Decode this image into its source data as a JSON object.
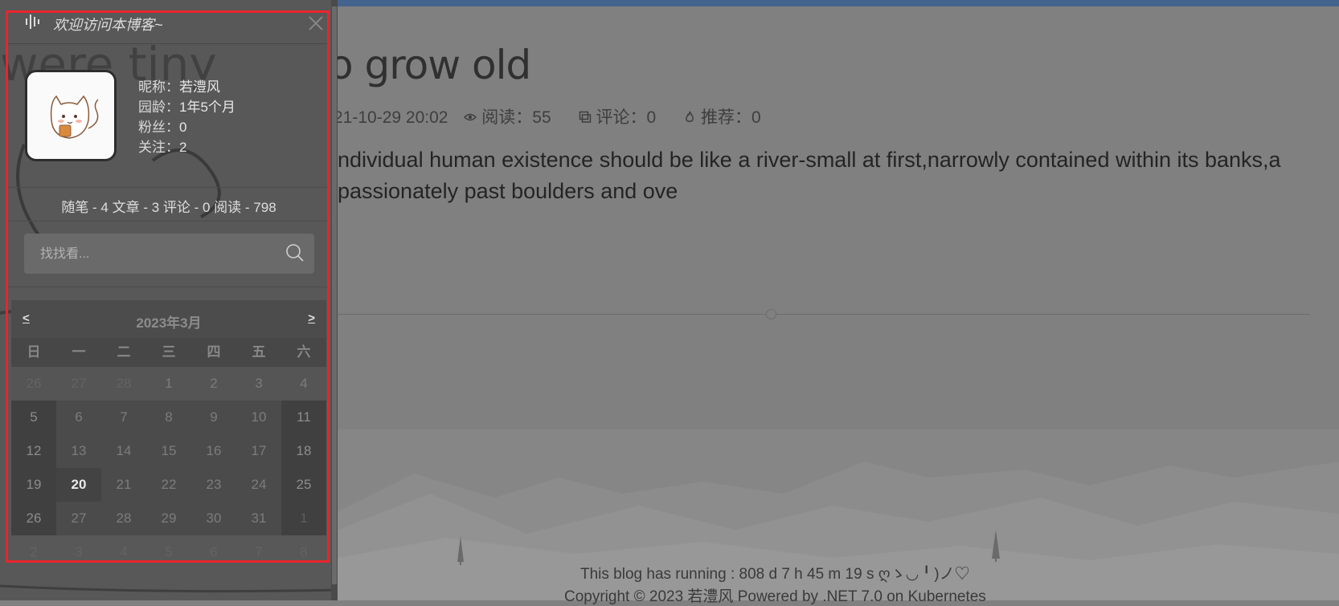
{
  "article": {
    "title": "How  o grow old",
    "date": "21-10-29 20:02",
    "views": "阅读：55",
    "comments": "评论：0",
    "recommends": "推荐：0",
    "summary_line1": "ndividual human existence should be like a river-small at first,narrowly contained within its banks,a",
    "summary_line2": "passionately past boulders and ove"
  },
  "footer": {
    "running": "This blog has running : 808 d 7 h 45 m 19 s  ღゝ◡╹)ノ♡",
    "copyright": "Copyright © 2023 若澧风 Powered by .NET 7.0 on Kubernetes"
  },
  "sidebar": {
    "welcome": "欢迎访问本博客~",
    "profile": [
      {
        "key": "昵称：",
        "value": "若澧风"
      },
      {
        "key": "园龄：",
        "value": "1年5个月"
      },
      {
        "key": "粉丝：",
        "value": "0"
      },
      {
        "key": "关注：",
        "value": "2"
      }
    ],
    "stats": "随笔 - 4  文章 - 3  评论 - 0  阅读 - 798",
    "search_placeholder": "找找看..."
  },
  "calendar": {
    "title": "2023年3月",
    "prev": "<",
    "next": ">",
    "weekdays": [
      "日",
      "一",
      "二",
      "三",
      "四",
      "五",
      "六"
    ],
    "today": "20",
    "weeks": [
      [
        "26",
        "27",
        "28",
        "1",
        "2",
        "3",
        "4"
      ],
      [
        "5",
        "6",
        "7",
        "8",
        "9",
        "10",
        "11"
      ],
      [
        "12",
        "13",
        "14",
        "15",
        "16",
        "17",
        "18"
      ],
      [
        "19",
        "20",
        "21",
        "22",
        "23",
        "24",
        "25"
      ],
      [
        "26",
        "27",
        "28",
        "29",
        "30",
        "31",
        "1"
      ],
      [
        "2",
        "3",
        "4",
        "5",
        "6",
        "7",
        "8"
      ]
    ],
    "other_month": [
      [
        true,
        true,
        true,
        false,
        false,
        false,
        false
      ],
      [
        false,
        false,
        false,
        false,
        false,
        false,
        false
      ],
      [
        false,
        false,
        false,
        false,
        false,
        false,
        false
      ],
      [
        false,
        false,
        false,
        false,
        false,
        false,
        false
      ],
      [
        false,
        false,
        false,
        false,
        false,
        false,
        true
      ],
      [
        true,
        true,
        true,
        true,
        true,
        true,
        true
      ]
    ]
  },
  "icons": [
    "waveform-icon",
    "close-icon",
    "search-icon",
    "eye-icon",
    "comment-icon",
    "fire-icon"
  ]
}
